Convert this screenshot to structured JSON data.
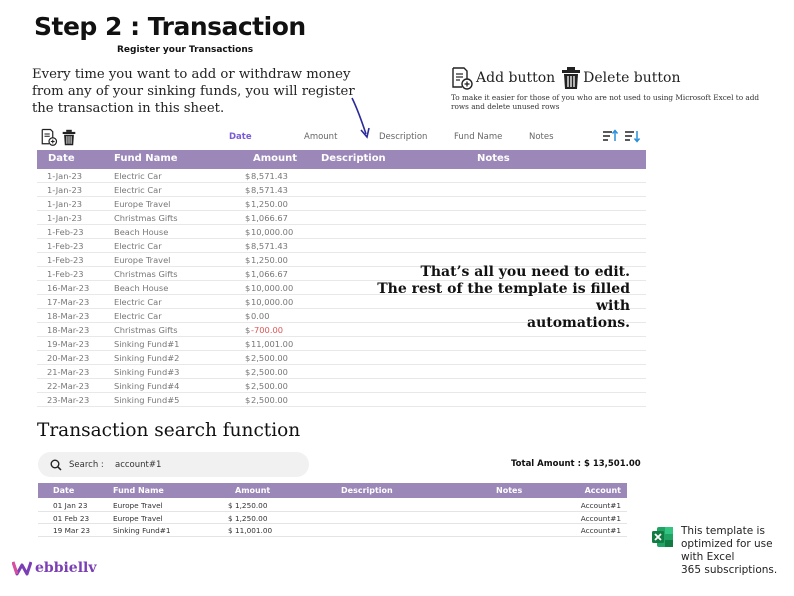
{
  "header": {
    "title": "Step 2 : Transaction",
    "subtitle": "Register your Transactions"
  },
  "intro": {
    "text": "Every time you want to add or withdraw money from any of your sinking funds, you will register the transaction in this sheet."
  },
  "button_legend": {
    "add_label": "Add button",
    "delete_label": "Delete button",
    "note": "To make it easier for those of you who are not used to using Microsoft Excel to add rows and delete unused rows"
  },
  "sort_tabs": {
    "date": "Date",
    "amount": "Amount",
    "description": "Description",
    "fund_name": "Fund Name",
    "notes": "Notes",
    "active_color": "#7b5cd6"
  },
  "table": {
    "headers": {
      "date": "Date",
      "fund_name": "Fund Name",
      "amount": "Amount",
      "description": "Description",
      "notes": "Notes"
    },
    "rows": [
      {
        "date": "1-Jan-23",
        "fund": "Electric Car",
        "cur": "$",
        "amount": "8,571.43",
        "negative": false
      },
      {
        "date": "1-Jan-23",
        "fund": "Electric Car",
        "cur": "$",
        "amount": "8,571.43",
        "negative": false
      },
      {
        "date": "1-Jan-23",
        "fund": "Europe Travel",
        "cur": "$",
        "amount": "1,250.00",
        "negative": false
      },
      {
        "date": "1-Jan-23",
        "fund": "Christmas Gifts",
        "cur": "$",
        "amount": "1,066.67",
        "negative": false
      },
      {
        "date": "1-Feb-23",
        "fund": "Beach  House",
        "cur": "$",
        "amount": "10,000.00",
        "negative": false
      },
      {
        "date": "1-Feb-23",
        "fund": "Electric Car",
        "cur": "$",
        "amount": "8,571.43",
        "negative": false
      },
      {
        "date": "1-Feb-23",
        "fund": "Europe Travel",
        "cur": "$",
        "amount": "1,250.00",
        "negative": false
      },
      {
        "date": "1-Feb-23",
        "fund": "Christmas Gifts",
        "cur": "$",
        "amount": "1,066.67",
        "negative": false
      },
      {
        "date": "16-Mar-23",
        "fund": "Beach  House",
        "cur": "$",
        "amount": "10,000.00",
        "negative": false
      },
      {
        "date": "17-Mar-23",
        "fund": "Electric Car",
        "cur": "$",
        "amount": "10,000.00",
        "negative": false
      },
      {
        "date": "18-Mar-23",
        "fund": "Electric Car",
        "cur": "$",
        "amount": "0.00",
        "negative": false
      },
      {
        "date": "18-Mar-23",
        "fund": "Christmas Gifts",
        "cur": "$",
        "amount": "-700.00",
        "negative": true
      },
      {
        "date": "19-Mar-23",
        "fund": "Sinking Fund#1",
        "cur": "$",
        "amount": "11,001.00",
        "negative": false
      },
      {
        "date": "20-Mar-23",
        "fund": "Sinking Fund#2",
        "cur": "$",
        "amount": "2,500.00",
        "negative": false
      },
      {
        "date": "21-Mar-23",
        "fund": "Sinking Fund#3",
        "cur": "$",
        "amount": "2,500.00",
        "negative": false
      },
      {
        "date": "22-Mar-23",
        "fund": "Sinking Fund#4",
        "cur": "$",
        "amount": "2,500.00",
        "negative": false
      },
      {
        "date": "23-Mar-23",
        "fund": "Sinking Fund#5",
        "cur": "$",
        "amount": "2,500.00",
        "negative": false
      }
    ],
    "negative_color": "#e05555",
    "header_color": "#9b87b8"
  },
  "overlay_note": {
    "line1": "That’s all you need to edit.",
    "line2": "The rest of the template is filled with",
    "line3": "automations."
  },
  "search": {
    "title": "Transaction search function",
    "label": "Search :",
    "value": "account#1",
    "total_label": "Total Amount :",
    "total_value": "$ 13,501.00"
  },
  "results": {
    "headers": {
      "date": "Date",
      "fund_name": "Fund Name",
      "amount": "Amount",
      "description": "Description",
      "notes": "Notes",
      "account": "Account"
    },
    "rows": [
      {
        "date": "01 Jan 23",
        "fund": "Europe Travel",
        "amount": "$  1,250.00",
        "account": "Account#1"
      },
      {
        "date": "01 Feb 23",
        "fund": "Europe Travel",
        "amount": "$  1,250.00",
        "account": "Account#1"
      },
      {
        "date": "19 Mar 23",
        "fund": "Sinking Fund#1",
        "amount": "$  11,001.00",
        "account": "Account#1"
      }
    ]
  },
  "brand": {
    "name": "ebbiellv",
    "initial": "W"
  },
  "excel_note": {
    "line1": "This template is",
    "line2": "optimized for use",
    "line3": "with Excel",
    "line4": "365 subscriptions."
  }
}
